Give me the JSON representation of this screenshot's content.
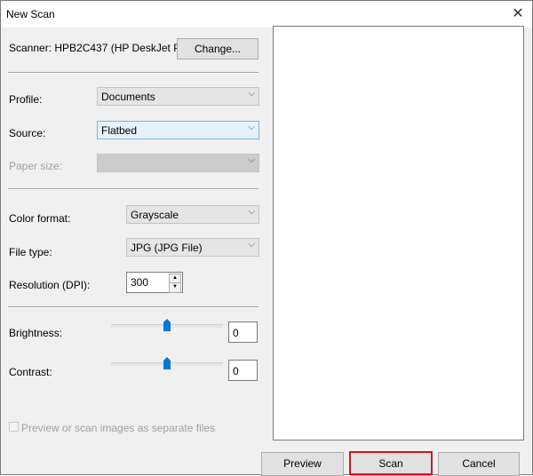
{
  "window": {
    "title": "New Scan",
    "close_icon": "close-icon"
  },
  "scanner": {
    "label": "Scanner: HPB2C437 (HP DeskJet Pl...",
    "change_button": "Change..."
  },
  "profile": {
    "label": "Profile:",
    "value": "Documents"
  },
  "source": {
    "label": "Source:",
    "value": "Flatbed"
  },
  "paper_size": {
    "label": "Paper size:",
    "value": ""
  },
  "color_format": {
    "label": "Color format:",
    "value": "Grayscale"
  },
  "file_type": {
    "label": "File type:",
    "value": "JPG (JPG File)"
  },
  "resolution": {
    "label": "Resolution (DPI):",
    "value": "300"
  },
  "brightness": {
    "label": "Brightness:",
    "value": "0",
    "level_percent": 50
  },
  "contrast": {
    "label": "Contrast:",
    "value": "0",
    "level_percent": 50
  },
  "separate_files": {
    "label": "Preview or scan images as separate files",
    "checked": false
  },
  "buttons": {
    "preview": "Preview",
    "scan": "Scan",
    "cancel": "Cancel"
  },
  "colors": {
    "slider_thumb": "#0078d7",
    "selected_field": "#e5f1fb",
    "highlight": "#d9141c"
  }
}
